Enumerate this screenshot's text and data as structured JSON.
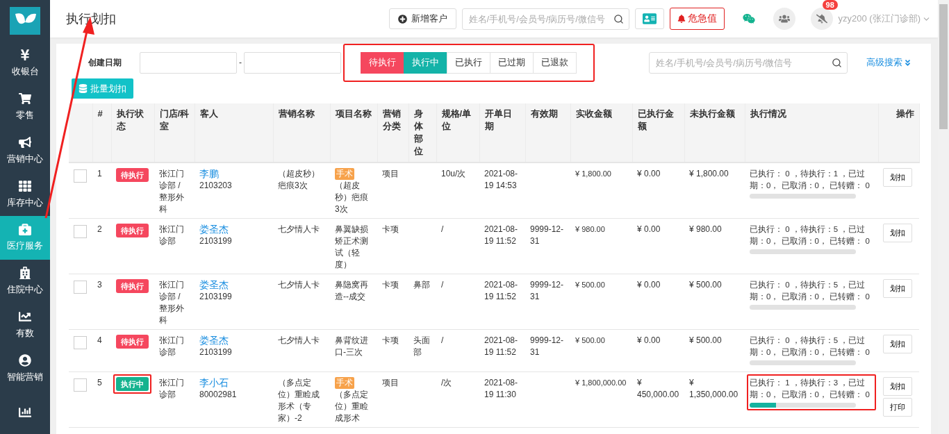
{
  "sidebar": {
    "items": [
      {
        "label": "收银台",
        "selected": false
      },
      {
        "label": "零售",
        "selected": false
      },
      {
        "label": "营销中心",
        "selected": false
      },
      {
        "label": "库存中心",
        "selected": false
      },
      {
        "label": "医疗服务",
        "selected": true
      },
      {
        "label": "住院中心",
        "selected": false
      },
      {
        "label": "有数",
        "selected": false
      },
      {
        "label": "智能营销",
        "selected": false
      },
      {
        "selected": false
      }
    ]
  },
  "header": {
    "title": "执行划扣",
    "new_customer": "新增客户",
    "search": {
      "placeholder": "姓名/手机号/会员号/病历号/微信号"
    },
    "alert_button": "危急值",
    "notification_badge": "98",
    "user": "yzy200 (张江门诊部)"
  },
  "filters": {
    "date_label": "创建日期",
    "date_separator": "-",
    "status_tabs": {
      "highlighted": true,
      "tabs": [
        {
          "label": "待执行",
          "selected": true,
          "kind": "pending"
        },
        {
          "label": "执行中",
          "selected": true,
          "kind": "running"
        },
        {
          "label": "已执行",
          "selected": false,
          "kind": "done"
        },
        {
          "label": "已过期",
          "selected": false,
          "kind": "expired"
        },
        {
          "label": "已退款",
          "selected": false,
          "kind": "refunded"
        }
      ]
    },
    "search": {
      "placeholder": "姓名/手机号/会员号/病历号/微信号"
    },
    "advanced_search": "高级搜索",
    "batch_button": "批量划扣"
  },
  "table": {
    "columns": [
      "#",
      "执行状态",
      "门店/科室",
      "客人",
      "营销名称",
      "项目名称",
      "营销分类",
      "身体部位",
      "规格/单位",
      "开单日期",
      "有效期",
      "实收金额",
      "已执行金额",
      "未执行金额",
      "执行情况",
      "操作"
    ],
    "rows": [
      {
        "checked": false,
        "index": "1",
        "status": {
          "label": "待执行",
          "kind": "pending"
        },
        "status_highlighted": false,
        "store": "张江门诊部 / 整形外科",
        "customer": "李鹏",
        "customer_id": "2103203",
        "campaign": "（超皮秒）疤痕3次",
        "project_tag": "手术",
        "project": "（超皮秒）疤痕3次",
        "category": "项目",
        "body_part": "",
        "spec": "10u/次",
        "date": "2021-08-19 14:53",
        "validity": "",
        "paid": "¥ 1,800.00",
        "executed": "¥ 0.00",
        "unexecuted": "¥ 1,800.00",
        "progress": "已执行： 0 ，待执行：1 ，已过期：0， 已取消：0， 已转赠： 0",
        "level": 0,
        "progress_highlighted": false,
        "actions": [
          "划扣"
        ]
      },
      {
        "checked": false,
        "index": "2",
        "status": {
          "label": "待执行",
          "kind": "pending"
        },
        "status_highlighted": false,
        "store": "张江门诊部",
        "customer": "娄圣杰",
        "customer_id": "2103199",
        "campaign": "七夕情人卡",
        "project": "鼻翼缺损矫正术测试（轻度）",
        "category": "卡项",
        "body_part": "",
        "spec": "/",
        "date": "2021-08-19 11:52",
        "validity": "9999-12-31",
        "paid": "¥ 980.00",
        "executed": "¥ 0.00",
        "unexecuted": "¥ 980.00",
        "progress": "已执行： 0 ，待执行：5 ，已过期：0， 已取消：0， 已转赠： 0",
        "level": 0,
        "progress_highlighted": false,
        "actions": [
          "划扣"
        ]
      },
      {
        "checked": false,
        "index": "3",
        "status": {
          "label": "待执行",
          "kind": "pending"
        },
        "status_highlighted": false,
        "store": "张江门诊部 / 整形外科",
        "customer": "娄圣杰",
        "customer_id": "2103199",
        "campaign": "七夕情人卡",
        "project": "鼻隐窝再造--成交",
        "category": "卡项",
        "body_part": "鼻部",
        "spec": "/",
        "date": "2021-08-19 11:52",
        "validity": "9999-12-31",
        "paid": "¥ 500.00",
        "executed": "¥ 0.00",
        "unexecuted": "¥ 500.00",
        "progress": "已执行： 0 ，待执行：5 ，已过期：0， 已取消：0， 已转赠： 0",
        "level": 0,
        "progress_highlighted": false,
        "actions": [
          "划扣"
        ]
      },
      {
        "checked": false,
        "index": "4",
        "status": {
          "label": "待执行",
          "kind": "pending"
        },
        "status_highlighted": false,
        "store": "张江门诊部",
        "customer": "娄圣杰",
        "customer_id": "2103199",
        "campaign": "七夕情人卡",
        "project": "鼻背纹进口-三次",
        "category": "卡项",
        "body_part": "头面部",
        "spec": "/",
        "date": "2021-08-19 11:52",
        "validity": "9999-12-31",
        "paid": "¥ 500.00",
        "executed": "¥ 0.00",
        "unexecuted": "¥ 500.00",
        "progress": "已执行： 0 ，待执行：5 ，已过期：0， 已取消：0， 已转赠： 0",
        "level": 0,
        "progress_highlighted": false,
        "actions": [
          "划扣"
        ]
      },
      {
        "checked": false,
        "index": "5",
        "status": {
          "label": "执行中",
          "kind": "running"
        },
        "status_highlighted": true,
        "store": "张江门诊部",
        "customer": "李小石",
        "customer_id": "80002981",
        "campaign": "（多点定位）重睑成形术（专家）-2",
        "project_tag": "手术",
        "project": "（多点定位）重睑成形术",
        "category": "项目",
        "body_part": "",
        "spec": "/次",
        "date": "2021-08-19 11:30",
        "validity": "",
        "paid": "¥ 1,800,000.00",
        "executed": "¥ 450,000.00",
        "unexecuted": "¥ 1,350,000.00",
        "progress": "已执行： 1 ，待执行：3 ，已过期：0， 已取消：0， 已转赠： 0",
        "level": 0.25,
        "progress_highlighted": true,
        "actions": [
          "划扣",
          "打印"
        ]
      }
    ]
  }
}
